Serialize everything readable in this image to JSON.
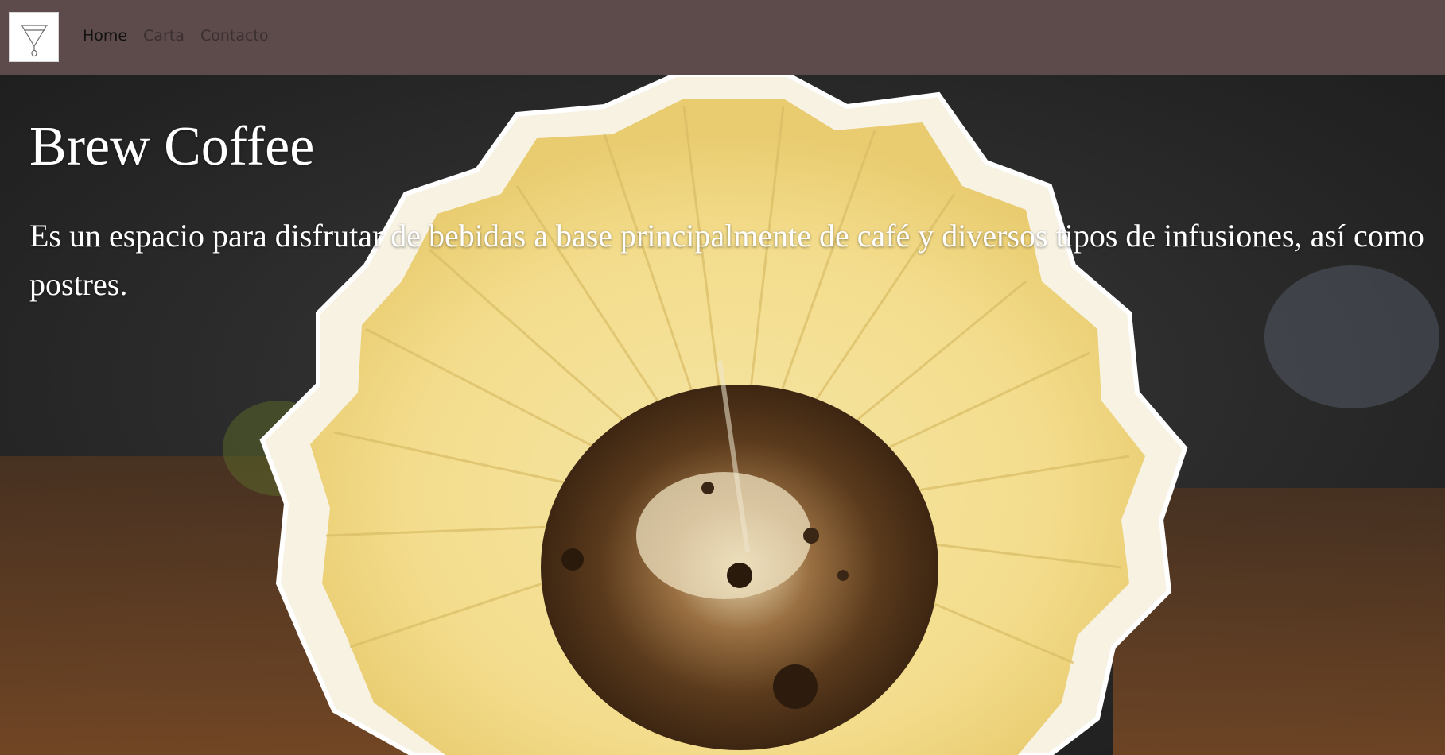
{
  "nav": {
    "logo_icon": "pour-over-dripper-icon",
    "links": [
      {
        "label": "Home"
      },
      {
        "label": "Carta"
      },
      {
        "label": "Contacto"
      }
    ]
  },
  "hero": {
    "title": "Brew Coffee",
    "description": "Es un espacio para disfrutar de bebidas a base principalmente de café y diversos tipos de infusiones, así como postres.",
    "image_subject": "pour-over-coffee-filter-photo"
  },
  "colors": {
    "navbar_bg": "#5d4a4b",
    "hero_text": "#ffffff"
  }
}
